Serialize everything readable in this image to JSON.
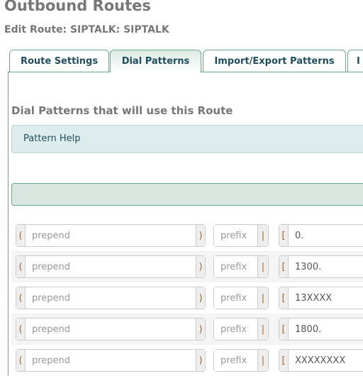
{
  "page": {
    "title": "Outbound Routes",
    "subtitle": "Edit Route: SIPTALK: SIPTALK"
  },
  "tabs": [
    {
      "label": "Route Settings"
    },
    {
      "label": "Dial Patterns",
      "active": true
    },
    {
      "label": "Import/Export Patterns"
    },
    {
      "label": "I"
    }
  ],
  "section": {
    "title": "Dial Patterns that will use this Route",
    "help_label": "Pattern Help"
  },
  "patterns": {
    "prepend_placeholder": "prepend",
    "prefix_placeholder": "prefix",
    "open_paren": "(",
    "close_paren": ")",
    "pipe": "|",
    "bracket": "[",
    "rows": [
      {
        "match": "0."
      },
      {
        "match": "1300."
      },
      {
        "match": "13XXXX"
      },
      {
        "match": "1800."
      },
      {
        "match": "XXXXXXXX"
      }
    ]
  },
  "colors": {
    "accent": "#6aa888",
    "tab_text": "#1f4e5f",
    "addon_text": "#a0672d"
  }
}
